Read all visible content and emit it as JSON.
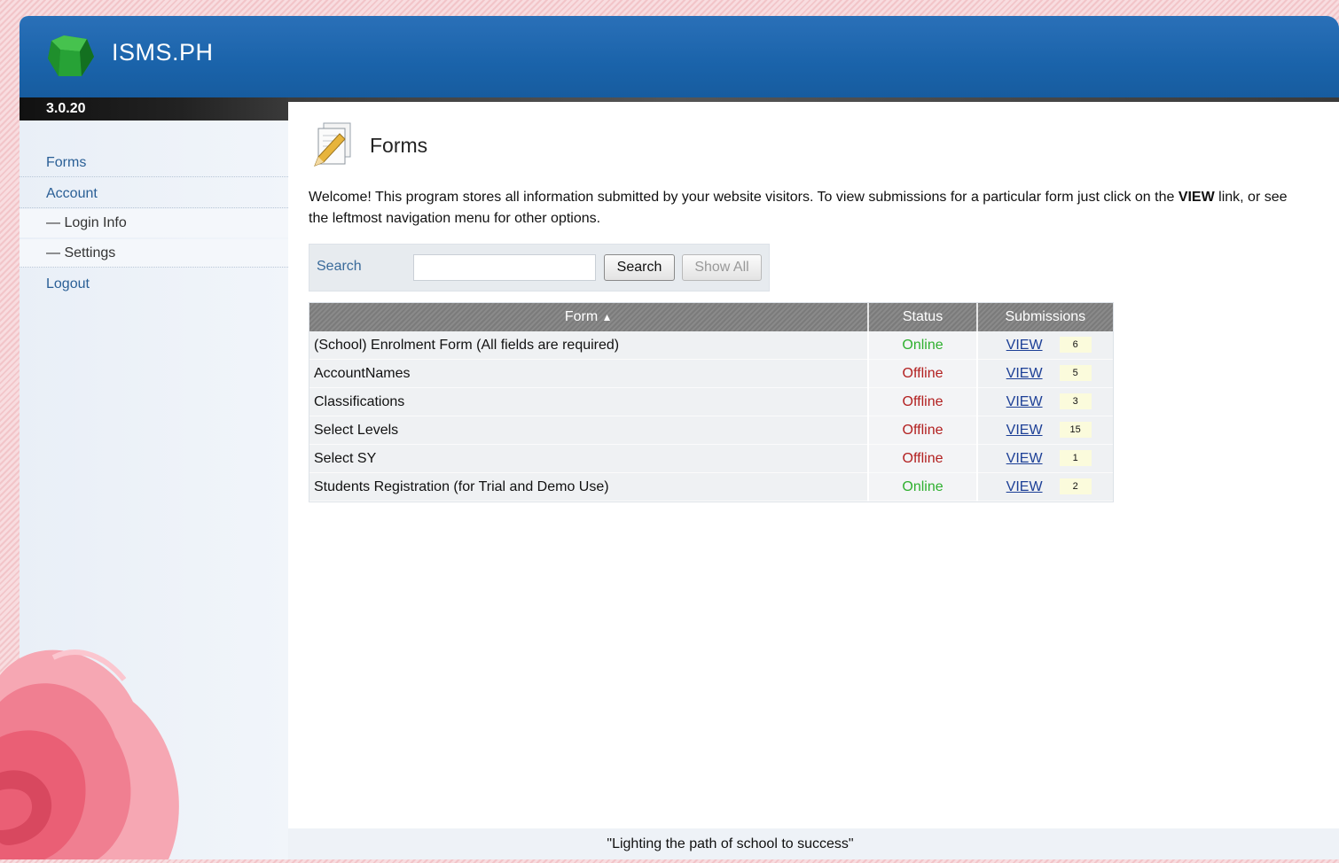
{
  "app": {
    "title": "ISMS.PH",
    "version": "3.0.20"
  },
  "sidebar": {
    "items": [
      {
        "label": "Forms"
      },
      {
        "label": "Account"
      },
      {
        "label": "Login Info"
      },
      {
        "label": "Settings"
      },
      {
        "label": "Logout"
      }
    ]
  },
  "page": {
    "title": "Forms",
    "intro_before": "Welcome! This program stores all information submitted by your website visitors. To view submissions for a particular form just click on the ",
    "intro_bold": "VIEW",
    "intro_after": " link, or see the leftmost navigation menu for other options."
  },
  "search": {
    "label": "Search",
    "value": "",
    "button": "Search",
    "show_all": "Show All"
  },
  "table": {
    "headers": {
      "form": "Form",
      "status": "Status",
      "submissions": "Submissions"
    },
    "rows": [
      {
        "form": "(School) Enrolment Form (All fields are required)",
        "status": "Online",
        "view": "VIEW",
        "count": "6"
      },
      {
        "form": "AccountNames",
        "status": "Offline",
        "view": "VIEW",
        "count": "5"
      },
      {
        "form": "Classifications",
        "status": "Offline",
        "view": "VIEW",
        "count": "3"
      },
      {
        "form": "Select Levels",
        "status": "Offline",
        "view": "VIEW",
        "count": "15"
      },
      {
        "form": "Select SY",
        "status": "Offline",
        "view": "VIEW",
        "count": "1"
      },
      {
        "form": "Students Registration (for Trial and Demo Use)",
        "status": "Online",
        "view": "VIEW",
        "count": "2"
      }
    ]
  },
  "footer": {
    "tagline": "\"Lighting the path of school to success\""
  },
  "colors": {
    "banner": "#1a63aa",
    "online": "#2fb02f",
    "offline": "#b21f1f",
    "link": "#1c3f96"
  }
}
